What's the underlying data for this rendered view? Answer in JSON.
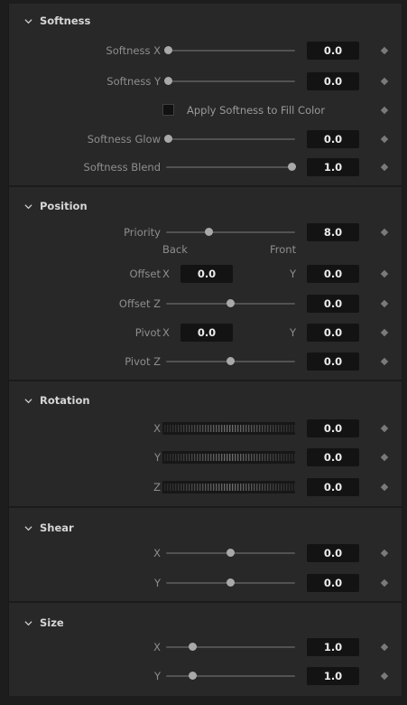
{
  "softness": {
    "title": "Softness",
    "x_label": "Softness X",
    "x_value": "0.0",
    "x_level": 0.0,
    "y_label": "Softness Y",
    "y_value": "0.0",
    "y_level": 0.0,
    "apply_fill_label": "Apply Softness to Fill Color",
    "apply_fill_checked": false,
    "glow_label": "Softness Glow",
    "glow_value": "0.0",
    "glow_level": 0.0,
    "blend_label": "Softness Blend",
    "blend_value": "1.0",
    "blend_level": 1.0
  },
  "position": {
    "title": "Position",
    "priority_label": "Priority",
    "priority_value": "8.0",
    "priority_back": "Back",
    "priority_front": "Front",
    "offset_label": "Offset",
    "offset_x_axis": "X",
    "offset_x_value": "0.0",
    "offset_y_axis": "Y",
    "offset_y_value": "0.0",
    "offset_z_label": "Offset Z",
    "offset_z_value": "0.0",
    "pivot_label": "Pivot",
    "pivot_x_axis": "X",
    "pivot_x_value": "0.0",
    "pivot_y_axis": "Y",
    "pivot_y_value": "0.0",
    "pivot_z_label": "Pivot Z",
    "pivot_z_value": "0.0"
  },
  "rotation": {
    "title": "Rotation",
    "x_axis": "X",
    "x_value": "0.0",
    "y_axis": "Y",
    "y_value": "0.0",
    "z_axis": "Z",
    "z_value": "0.0"
  },
  "shear": {
    "title": "Shear",
    "x_axis": "X",
    "x_value": "0.0",
    "y_axis": "Y",
    "y_value": "0.0"
  },
  "size": {
    "title": "Size",
    "x_axis": "X",
    "x_value": "1.0",
    "y_axis": "Y",
    "y_value": "1.0"
  },
  "icons": {
    "collapse": "chevron-down-icon",
    "keyframe": "keyframe-diamond-icon",
    "jog": "jog-wheel-icon"
  },
  "colors": {
    "panel_bg": "#282828",
    "field_bg": "#131313",
    "field_text": "#ececec",
    "label_text": "#8e8e8e",
    "header_text": "#d6d6d6"
  }
}
